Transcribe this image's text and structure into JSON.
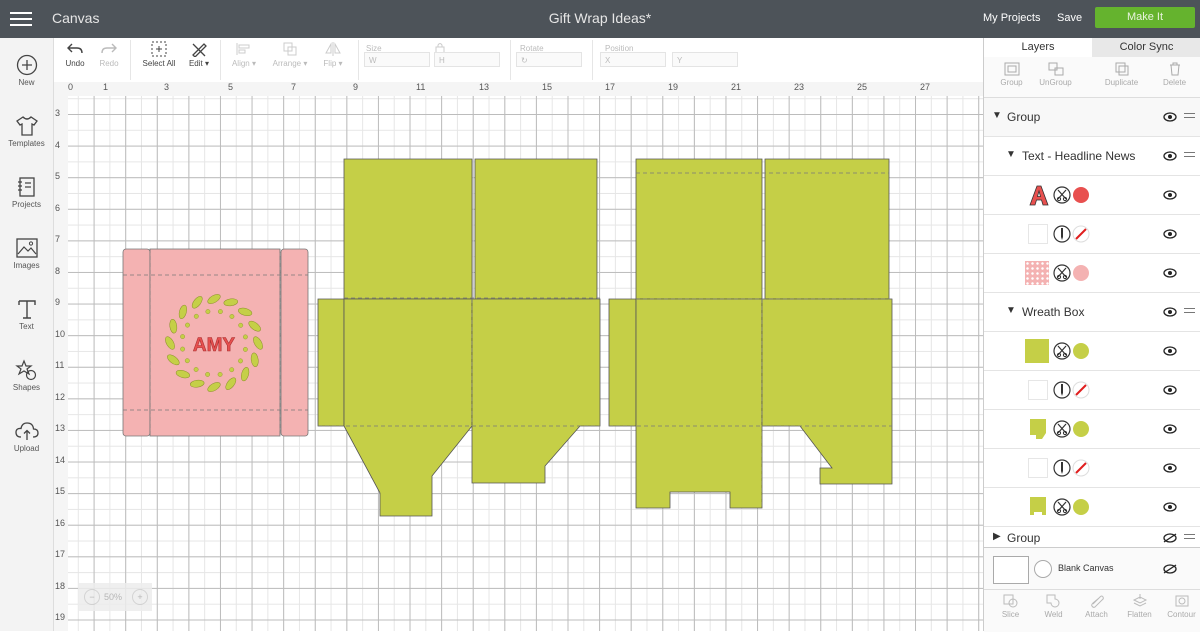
{
  "topbar": {
    "app_name": "Canvas",
    "document_title": "Gift Wrap Ideas*",
    "my_projects": "My Projects",
    "save": "Save",
    "make_it": "Make It"
  },
  "sidebar": {
    "items": [
      {
        "label": "New",
        "icon": "plus-circle-icon"
      },
      {
        "label": "Templates",
        "icon": "tshirt-icon"
      },
      {
        "label": "Projects",
        "icon": "projects-icon"
      },
      {
        "label": "Images",
        "icon": "image-icon"
      },
      {
        "label": "Text",
        "icon": "text-icon"
      },
      {
        "label": "Shapes",
        "icon": "shapes-icon"
      },
      {
        "label": "Upload",
        "icon": "cloud-upload-icon"
      }
    ]
  },
  "toolbar": {
    "undo": "Undo",
    "redo": "Redo",
    "select_all": "Select All",
    "edit": "Edit",
    "align": "Align",
    "arrange": "Arrange",
    "flip": "Flip",
    "size": "Size",
    "size_w": "W",
    "size_h": "H",
    "rotate": "Rotate",
    "position": "Position",
    "pos_x": "X",
    "pos_y": "Y"
  },
  "rulers": {
    "horizontal": [
      "0",
      "1",
      "3",
      "5",
      "7",
      "9",
      "11",
      "13",
      "15",
      "17",
      "19",
      "21",
      "23",
      "25",
      "27"
    ],
    "vertical": [
      "3",
      "4",
      "5",
      "6",
      "7",
      "8",
      "9",
      "10",
      "11",
      "12",
      "13",
      "14",
      "15",
      "16",
      "17",
      "18",
      "19"
    ]
  },
  "zoom": {
    "level": "50%"
  },
  "canvas": {
    "name_text": "AMY",
    "colors": {
      "pink": "#f4b2b2",
      "green": "#c5cf47",
      "red_text": "#e8504f"
    }
  },
  "panel": {
    "tabs": [
      "Layers",
      "Color Sync"
    ],
    "actions": [
      "Group",
      "UnGroup",
      "Duplicate",
      "Delete"
    ],
    "layers": {
      "group1": "Group",
      "text_group": "Text - Headline News",
      "wreath_box": "Wreath Box",
      "group2": "Group"
    },
    "blank_canvas": "Blank Canvas",
    "bottom_actions": [
      "Slice",
      "Weld",
      "Attach",
      "Flatten",
      "Contour"
    ]
  }
}
